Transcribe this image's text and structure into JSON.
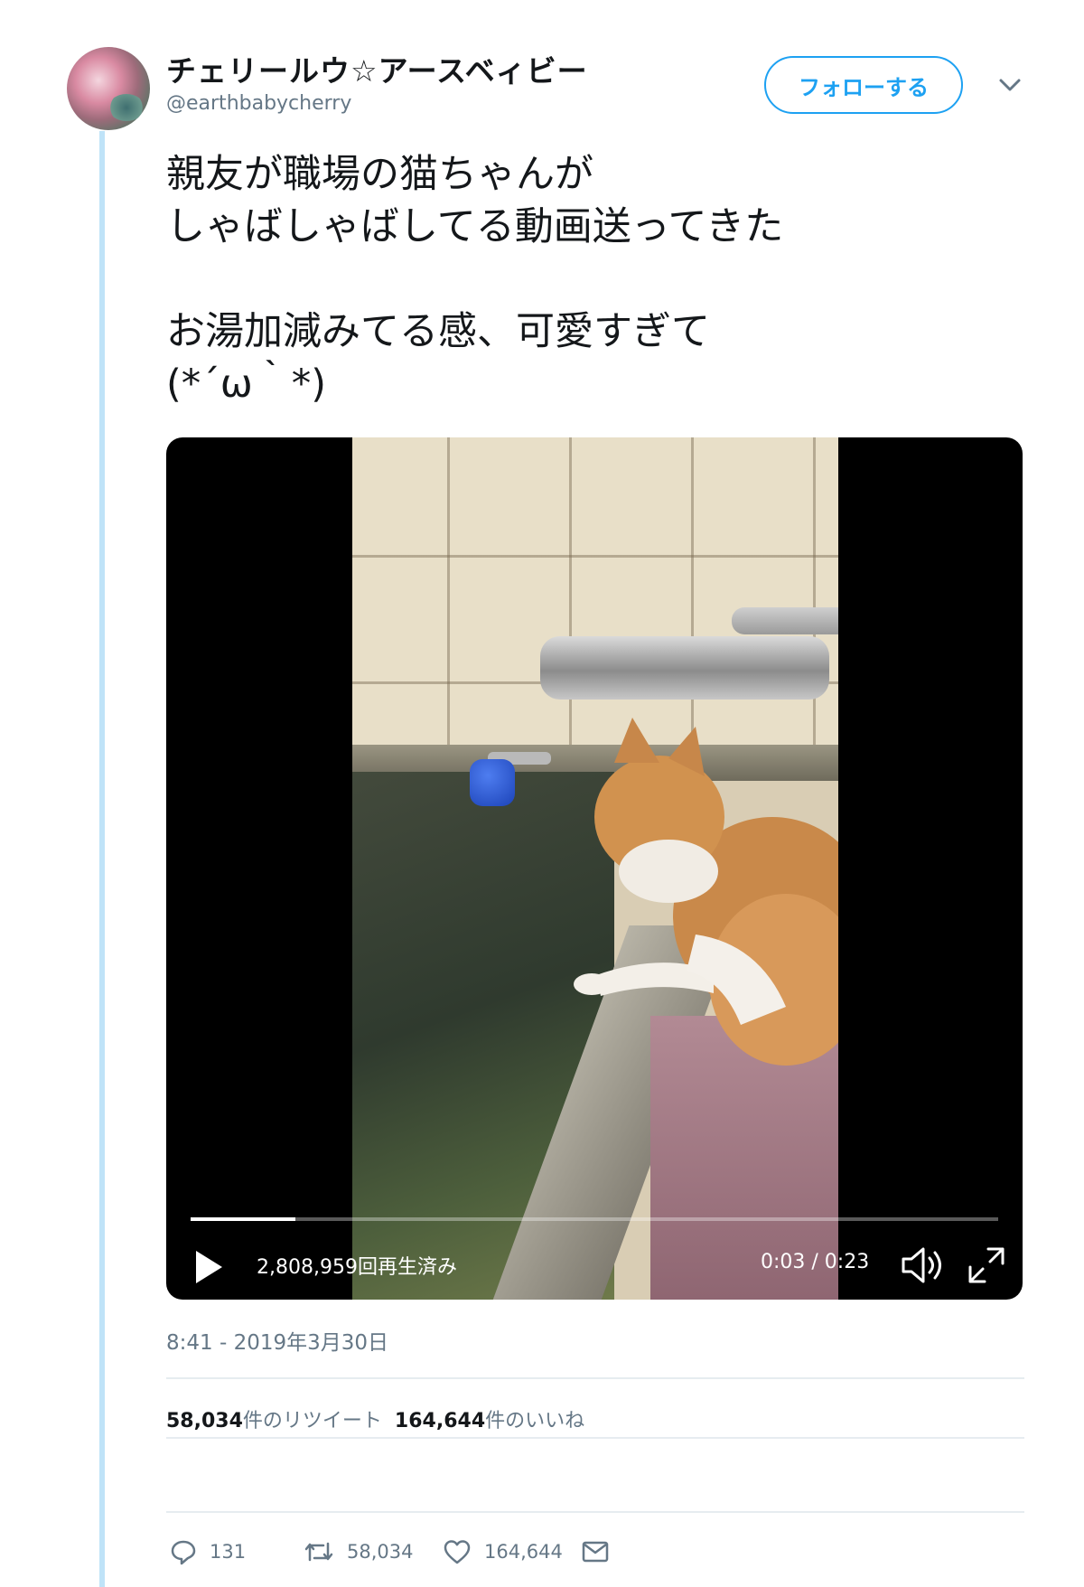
{
  "user": {
    "display_name": "チェリールウ☆アースベィビー",
    "handle": "@earthbabycherry",
    "follow_label": "フォローする"
  },
  "tweet": {
    "text_lines": [
      "親友が職場の猫ちゃんが",
      "しゃばしゃばしてる動画送ってきた",
      "",
      "お湯加減みてる感、可愛すぎて",
      "(*´ω｀*)"
    ],
    "timestamp": "8:41 - 2019年3月30日"
  },
  "video": {
    "view_count": "2,808,959回再生済み",
    "time": "0:03 / 0:23",
    "progress_fraction": 0.13
  },
  "stats": {
    "retweets_count": "58,034",
    "retweets_suffix": "件のリツイート",
    "likes_count": "164,644",
    "likes_suffix": "件のいいね"
  },
  "actions": {
    "reply_count": "131",
    "retweet_count": "58,034",
    "like_count": "164,644"
  },
  "colors": {
    "accent": "#1da1f2",
    "thread_line": "#bfe3f8",
    "secondary_text": "#657786"
  }
}
